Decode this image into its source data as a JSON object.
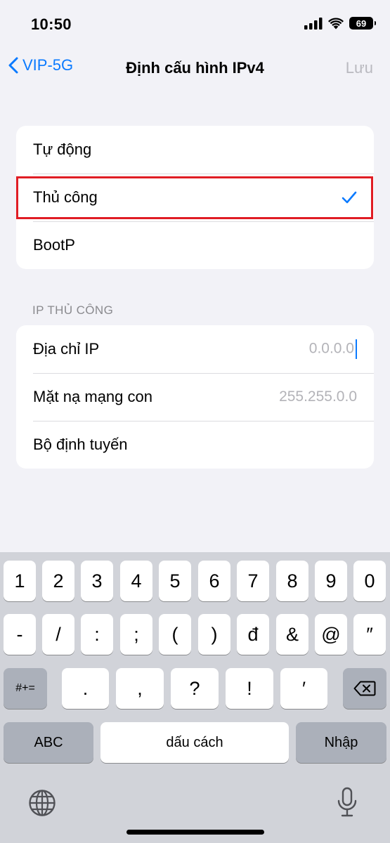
{
  "status_bar": {
    "time": "10:50",
    "battery": "69"
  },
  "nav": {
    "back_label": "VIP-5G",
    "title": "Định cấu hình IPv4",
    "save_label": "Lưu"
  },
  "config_options": [
    {
      "label": "Tự động"
    },
    {
      "label": "Thủ công",
      "selected": true
    },
    {
      "label": "BootP"
    }
  ],
  "manual_section": {
    "header": "IP THỦ CÔNG",
    "fields": [
      {
        "label": "Địa chỉ IP",
        "placeholder": "0.0.0.0"
      },
      {
        "label": "Mặt nạ mạng con",
        "placeholder": "255.255.0.0"
      },
      {
        "label": "Bộ định tuyến",
        "placeholder": ""
      }
    ]
  },
  "keyboard": {
    "row1": [
      "1",
      "2",
      "3",
      "4",
      "5",
      "6",
      "7",
      "8",
      "9",
      "0"
    ],
    "row2": [
      "-",
      "/",
      ":",
      ";",
      "(",
      ")",
      "đ",
      "&",
      "@",
      "″"
    ],
    "row3": {
      "symbols_toggle": "#+=",
      "keys": [
        ".",
        ",",
        "?",
        "!",
        "′"
      ]
    },
    "abc_label": "ABC",
    "space_label": "dấu cách",
    "return_label": "Nhập"
  },
  "colors": {
    "accent": "#0a7aff",
    "highlight_border": "#e01d24",
    "background": "#f2f2f7"
  }
}
